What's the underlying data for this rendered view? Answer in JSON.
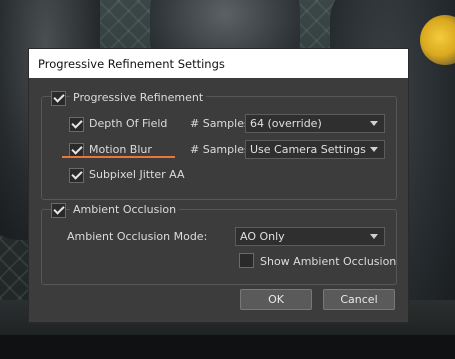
{
  "dialog": {
    "title": "Progressive Refinement Settings"
  },
  "progressive": {
    "label": "Progressive Refinement",
    "checked": true,
    "samples_label": "# Samples",
    "dof": {
      "label": "Depth Of Field",
      "checked": true,
      "samples": "64 (override)"
    },
    "motion_blur": {
      "label": "Motion Blur",
      "checked": true,
      "samples": "Use Camera Settings"
    },
    "subpixel": {
      "label": "Subpixel Jitter AA",
      "checked": true
    }
  },
  "ambient": {
    "label": "Ambient Occlusion",
    "checked": true,
    "mode_label": "Ambient Occlusion Mode:",
    "mode_value": "AO Only",
    "show_label": "Show Ambient Occlusion",
    "show_checked": false
  },
  "buttons": {
    "ok": "OK",
    "cancel": "Cancel"
  },
  "colors": {
    "highlight_underline": "#e6783a",
    "dialog_bg": "#3c3c3c",
    "title_bg": "#ffffff"
  }
}
